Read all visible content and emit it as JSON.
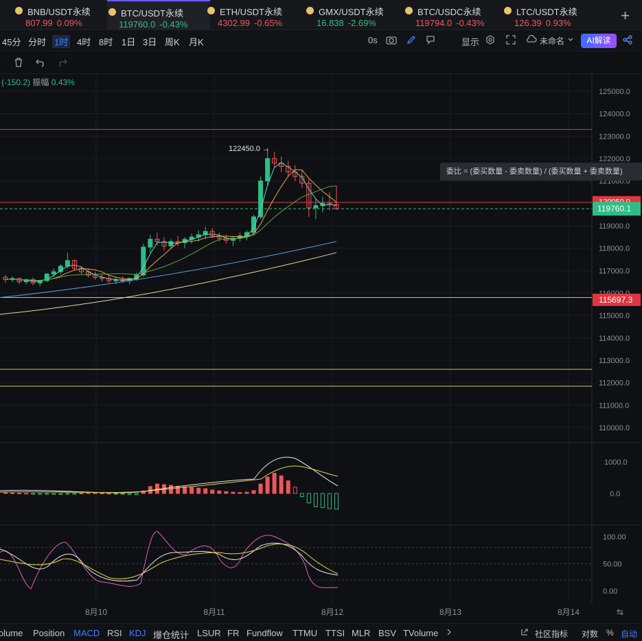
{
  "tickers": [
    {
      "name": "BNB/USDT永续",
      "price": "807.99",
      "change": "0.09%",
      "dir": "red"
    },
    {
      "name": "BTC/USDT永续",
      "price": "119760.0",
      "change": "-0.43%",
      "dir": "green"
    },
    {
      "name": "ETH/USDT永续",
      "price": "4302.99",
      "change": "-0.65%",
      "dir": "red"
    },
    {
      "name": "GMX/USDT永续",
      "price": "16.838",
      "change": "-2.69%",
      "dir": "green"
    },
    {
      "name": "BTC/USDC永续",
      "price": "119794.0",
      "change": "-0.43%",
      "dir": "red"
    },
    {
      "name": "LTC/USDT永续",
      "price": "126.39",
      "change": "0.93%",
      "dir": "red"
    }
  ],
  "add_tab": "+",
  "timeframes": [
    "45分",
    "分时",
    "1时",
    "4时",
    "8时",
    "1日",
    "3日",
    "周K",
    "月K"
  ],
  "active_timeframe": "1时",
  "toolbar": {
    "countdown": "0s",
    "display": "显示",
    "layout_name": "未命名",
    "ai": "AI解读"
  },
  "info": {
    "delta": "(-150.2)",
    "amplitude_label": "振幅",
    "amplitude": "0.43%"
  },
  "tooltip": "委比 = (委买数量 - 委卖数量) / (委买数量 + 委卖数量)",
  "chart_data": {
    "type": "candlestick",
    "price_axis": [
      "125000.0",
      "124000.0",
      "123000.0",
      "122000.0",
      "121000.0",
      "120000.0",
      "119000.0",
      "118000.0",
      "117000.0",
      "116000.0",
      "115000.0",
      "114000.0",
      "113000.0",
      "112000.0",
      "111000.0",
      "110000.0"
    ],
    "price_range": [
      109700,
      125300
    ],
    "current_price": "119760.1",
    "alert_price_1": "120050.0",
    "alert_price_2": "115697.3",
    "high_marker": "122450.0",
    "horizontal_lines": [
      123300,
      120050,
      115800,
      112600,
      111850
    ],
    "macd_axis": [
      "1000.0",
      "0.0"
    ],
    "kdj_axis": [
      "100.00",
      "50.00",
      "0.00"
    ],
    "dates": [
      "8月10",
      "8月11",
      "8月12",
      "8月13",
      "8月14"
    ],
    "candles": [
      [
        116700,
        116800,
        116450,
        116600
      ],
      [
        116600,
        116750,
        116500,
        116650
      ],
      [
        116650,
        116700,
        116400,
        116500
      ],
      [
        116500,
        116650,
        116400,
        116600
      ],
      [
        116600,
        116700,
        116350,
        116450
      ],
      [
        116450,
        116600,
        116300,
        116550
      ],
      [
        116550,
        116900,
        116500,
        116850
      ],
      [
        116850,
        117100,
        116700,
        116950
      ],
      [
        116950,
        117300,
        116850,
        117200
      ],
      [
        117200,
        117800,
        117100,
        117450
      ],
      [
        117450,
        117500,
        117000,
        117100
      ],
      [
        117100,
        117200,
        116850,
        116950
      ],
      [
        116950,
        117100,
        116700,
        116800
      ],
      [
        116800,
        116950,
        116600,
        116700
      ],
      [
        116700,
        116850,
        116500,
        116650
      ],
      [
        116650,
        116800,
        116450,
        116550
      ],
      [
        116550,
        116700,
        116400,
        116600
      ],
      [
        116600,
        116750,
        116450,
        116550
      ],
      [
        116550,
        116700,
        116400,
        116650
      ],
      [
        116650,
        116900,
        116550,
        116800
      ],
      [
        116800,
        118200,
        116750,
        118050
      ],
      [
        118050,
        118600,
        117800,
        118400
      ],
      [
        118400,
        118700,
        118100,
        118300
      ],
      [
        118300,
        118500,
        117900,
        118100
      ],
      [
        118100,
        118400,
        117950,
        118300
      ],
      [
        118300,
        118550,
        118100,
        118250
      ],
      [
        118250,
        118500,
        118000,
        118400
      ],
      [
        118400,
        118650,
        118200,
        118500
      ],
      [
        118500,
        118800,
        118300,
        118600
      ],
      [
        118600,
        118950,
        118400,
        118750
      ],
      [
        118750,
        118900,
        118450,
        118550
      ],
      [
        118550,
        118700,
        118300,
        118450
      ],
      [
        118450,
        118600,
        118200,
        118350
      ],
      [
        118350,
        118500,
        118100,
        118450
      ],
      [
        118450,
        118700,
        118300,
        118550
      ],
      [
        118550,
        118800,
        118350,
        118700
      ],
      [
        118700,
        119500,
        118600,
        119400
      ],
      [
        119400,
        121200,
        119300,
        121000
      ],
      [
        121000,
        122450,
        120800,
        122000
      ],
      [
        122000,
        122300,
        121600,
        121800
      ],
      [
        121800,
        122100,
        121400,
        121650
      ],
      [
        121650,
        121900,
        121200,
        121400
      ],
      [
        121400,
        121700,
        121000,
        121200
      ],
      [
        121200,
        121500,
        120700,
        120900
      ],
      [
        120900,
        121100,
        119400,
        119800
      ],
      [
        119800,
        120200,
        119300,
        119900
      ],
      [
        119900,
        120300,
        119600,
        120000
      ],
      [
        120000,
        120500,
        119700,
        119950
      ],
      [
        119950,
        120800,
        119700,
        119760
      ]
    ]
  },
  "indicator_tabs": [
    "olume",
    "Position",
    "MACD",
    "RSI",
    "KDJ",
    "爆仓统计",
    "LSUR",
    "FR",
    "Fundflow",
    "TTMU",
    "TTSI",
    "MLR",
    "BSV",
    "TVolume"
  ],
  "active_indicators": [
    "MACD",
    "KDJ"
  ],
  "bottom_right": {
    "community": "社区指标",
    "log": "对数",
    "percent": "%",
    "auto": "自动"
  }
}
